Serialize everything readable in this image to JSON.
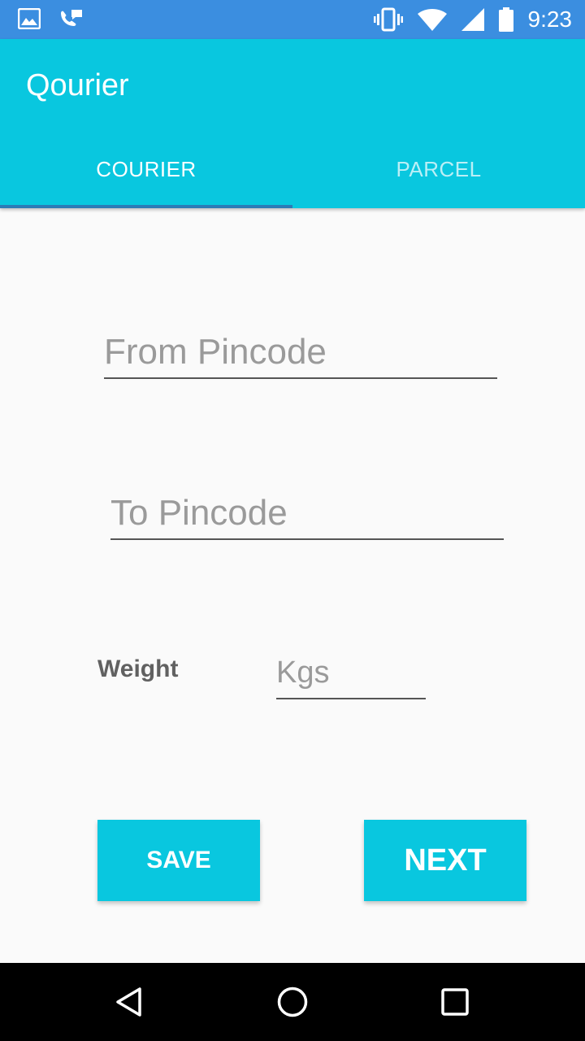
{
  "status_bar": {
    "time": "9:23",
    "left_icons": [
      "image-icon",
      "phone-chat-icon"
    ],
    "right_icons": [
      "vibrate-icon",
      "wifi-icon",
      "signal-icon",
      "battery-icon"
    ]
  },
  "app": {
    "title": "Qourier",
    "color": "#09c7df"
  },
  "tabs": [
    {
      "label": "COURIER",
      "active": true
    },
    {
      "label": "PARCEL",
      "active": false
    }
  ],
  "form": {
    "from_placeholder": "From Pincode",
    "to_placeholder": "To Pincode",
    "weight_label": "Weight",
    "weight_placeholder": "Kgs"
  },
  "buttons": {
    "save_label": "SAVE",
    "next_label": "NEXT"
  },
  "nav_bar": {
    "icons": [
      "back-icon",
      "home-icon",
      "recents-icon"
    ]
  }
}
